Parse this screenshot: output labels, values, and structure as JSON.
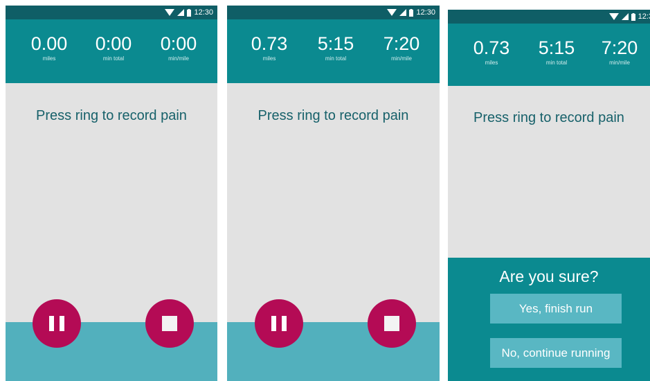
{
  "status_bar": {
    "time_full": "12:30",
    "time_clipped": "12:3"
  },
  "stat_labels": {
    "miles": "miles",
    "min_total": "min total",
    "min_per_mile": "min/mile"
  },
  "screens": [
    {
      "miles": "0.00",
      "min_total": "0:00",
      "min_per_mile": "0:00"
    },
    {
      "miles": "0.73",
      "min_total": "5:15",
      "min_per_mile": "7:20"
    },
    {
      "miles": "0.73",
      "min_total": "5:15",
      "min_per_mile": "7:20"
    }
  ],
  "prompt": "Press ring to record pain",
  "confirm": {
    "title": "Are you sure?",
    "yes_label": "Yes, finish run",
    "no_label": "No, continue running"
  },
  "icons": {
    "pause": "pause-icon",
    "stop": "stop-icon",
    "wifi": "wifi-icon",
    "signal": "signal-icon",
    "battery": "battery-icon"
  },
  "colors": {
    "header": "#0b8a90",
    "status_bar": "#0f5e66",
    "accent_button": "#b40b55",
    "bottom_band": "#52b0bd",
    "body": "#e2e2e2",
    "prompt_text": "#17616a"
  }
}
